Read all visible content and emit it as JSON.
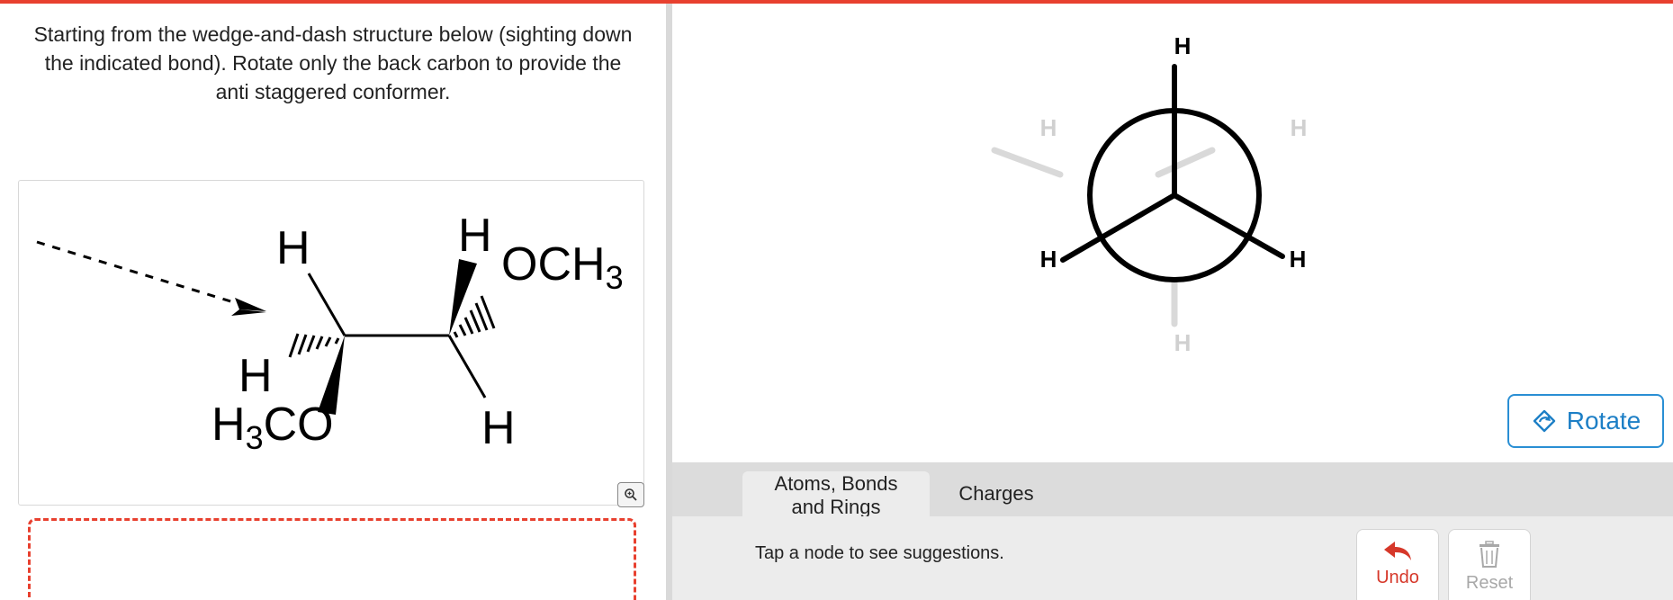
{
  "colors": {
    "accent": "#e8402f",
    "rotate_blue": "#1d7fc6",
    "faded_bond": "#d9d9d9",
    "tab_bar": "#dcdcdc",
    "tools_bg": "#ececec"
  },
  "question": {
    "text": "Starting from the wedge-and-dash structure below (sighting down the indicated bond). Rotate only the back carbon to provide the anti staggered conformer."
  },
  "structure": {
    "labels": {
      "h_top_left": "H",
      "h_top_right": "H",
      "och3": "OCH",
      "och3_sub": "3",
      "h_left_dash": "H",
      "h3co_h": "H",
      "h3co_sub": "3",
      "h3co_co": "CO",
      "h_bottom_right": "H"
    },
    "zoom_icon": "zoom-in-icon"
  },
  "newman": {
    "front": [
      "H",
      "H",
      "H"
    ],
    "back": [
      "H",
      "H",
      "H"
    ]
  },
  "rotate_button": {
    "label": "Rotate",
    "icon": "rotate-icon"
  },
  "tabs": [
    {
      "label_line1": "Atoms, Bonds",
      "label_line2": "and Rings",
      "active": true
    },
    {
      "label": "Charges",
      "active": false
    }
  ],
  "tools": {
    "hint": "Tap a node to see suggestions.",
    "undo_label": "Undo",
    "undo_icon": "undo-arrow-icon",
    "reset_label": "Reset",
    "reset_icon": "trash-icon"
  }
}
